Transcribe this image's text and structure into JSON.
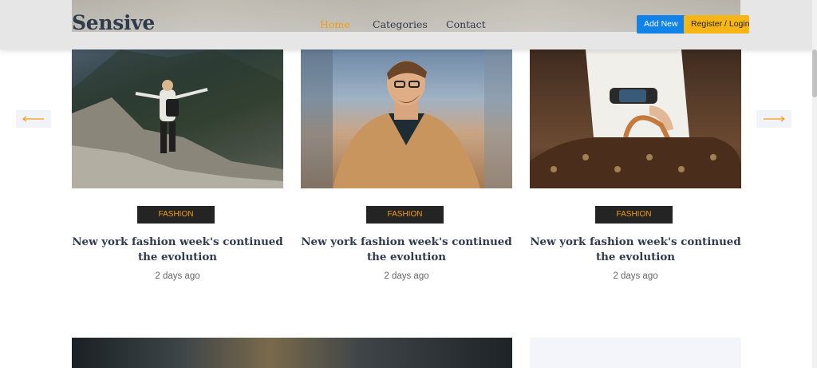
{
  "header": {
    "logo": "Sensive",
    "nav": [
      {
        "label": "Home",
        "active": true
      },
      {
        "label": "Categories",
        "active": false
      },
      {
        "label": "Contact",
        "active": false
      }
    ],
    "add_new_label": "Add New",
    "login_label": "Register / Login"
  },
  "carousel": {
    "prev_icon": "arrow-left-icon",
    "next_icon": "arrow-right-icon",
    "cards": [
      {
        "image": "hiker-on-mountain-trail-photo",
        "category": "Fashion",
        "title": "New york fashion week's continued the evolution",
        "meta": "2 days ago"
      },
      {
        "image": "man-in-camel-coat-photo",
        "category": "Fashion",
        "title": "New york fashion week's continued the evolution",
        "meta": "2 days ago"
      },
      {
        "image": "woman-with-leather-bag-photo",
        "category": "Fashion",
        "title": "New york fashion week's continued the evolution",
        "meta": "2 days ago"
      }
    ]
  },
  "colors": {
    "accent": "#f39c12",
    "primary_button": "#1183e8",
    "login_button": "#f7b615",
    "heading": "#2f3a4d",
    "badge_bg": "#242424"
  }
}
